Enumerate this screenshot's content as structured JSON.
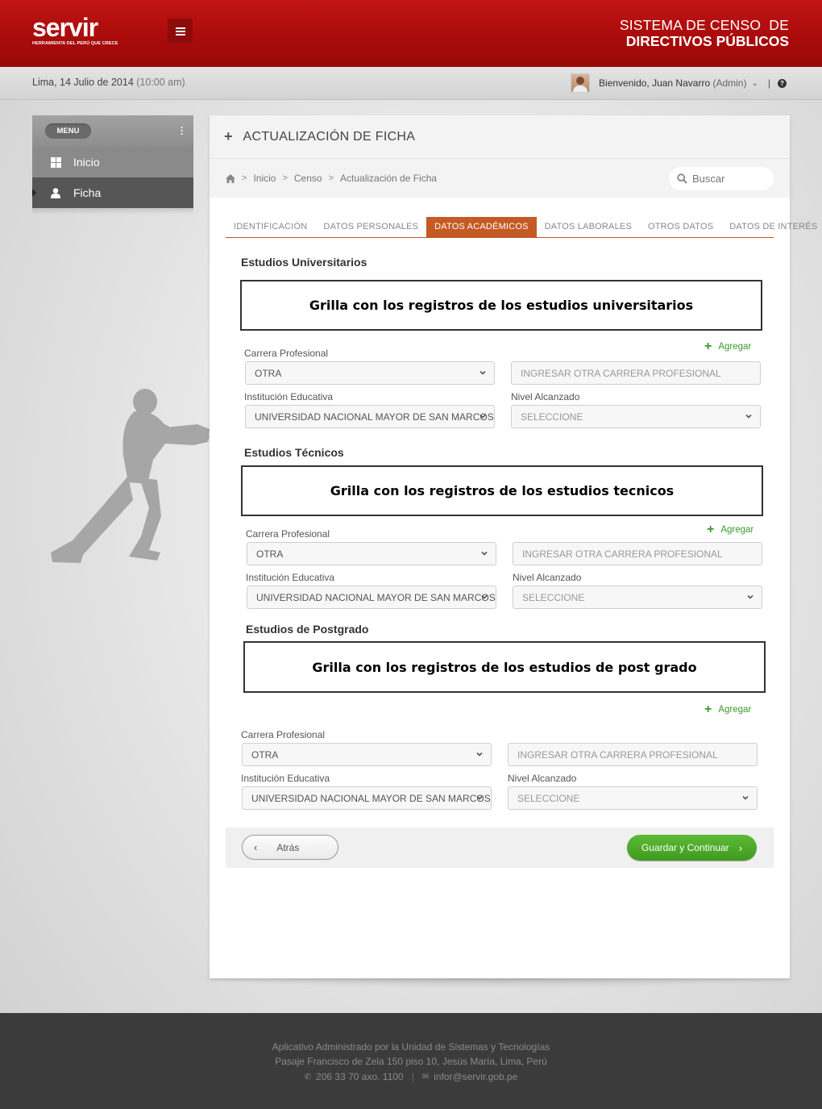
{
  "header": {
    "logo": "servir",
    "logo_tagline": "HERRAMIENTA DEL PERÚ QUE CRECE",
    "title_line1": "SISTEMA DE CENSO  DE",
    "title_line2": "DIRECTIVOS PÚBLICOS"
  },
  "subbar": {
    "date": "Lima, 14 Julio de 2014",
    "time": "(10:00 am)",
    "welcome": "Bienvenido, Juan Navarro",
    "role": "(Admin)",
    "separator": "|"
  },
  "sidebar": {
    "menu_label": "MENU",
    "items": [
      {
        "label": "Inicio",
        "icon": "windows-icon"
      },
      {
        "label": "Ficha",
        "icon": "user-icon"
      }
    ]
  },
  "panel": {
    "title": "ACTUALIZACIÓN DE FICHA",
    "breadcrumb": [
      "Inicio",
      "Censo",
      "Actualización de Ficha"
    ],
    "search_placeholder": "Buscar"
  },
  "tabs": [
    {
      "label": "IDENTIFICACIÓN",
      "active": false
    },
    {
      "label": "DATOS PERSONALES",
      "active": false
    },
    {
      "label": "DATOS ACADÉMICOS",
      "active": true
    },
    {
      "label": "DATOS LABORALES",
      "active": false
    },
    {
      "label": "OTROS DATOS",
      "active": false
    },
    {
      "label": "DATOS DE INTERÉS",
      "active": false
    }
  ],
  "sections": {
    "universitarios": {
      "title": "Estudios Universitarios",
      "grid_text": "Grilla con los registros de los estudios universitarios",
      "add": "Agregar",
      "carrera_label": "Carrera Profesional",
      "carrera_value": "OTRA",
      "otra_placeholder": "INGRESAR OTRA CARRERA PROFESIONAL",
      "institucion_label": "Institución Educativa",
      "institucion_value": "UNIVERSIDAD NACIONAL MAYOR DE SAN MARCOS",
      "nivel_label": "Nivel Alcanzado",
      "nivel_value": "SELECCIONE"
    },
    "tecnicos": {
      "title": "Estudios Técnicos",
      "grid_text": "Grilla con los registros de los estudios tecnicos",
      "add": "Agregar",
      "carrera_label": "Carrera Profesional",
      "carrera_value": "OTRA",
      "otra_placeholder": "INGRESAR OTRA CARRERA PROFESIONAL",
      "institucion_label": "Institución Educativa",
      "institucion_value": "UNIVERSIDAD NACIONAL MAYOR DE SAN MARCOS",
      "nivel_label": "Nivel Alcanzado",
      "nivel_value": "SELECCIONE"
    },
    "postgrado": {
      "title": "Estudios de Postgrado",
      "grid_text": "Grilla con los registros de los estudios de post grado",
      "add": "Agregar",
      "carrera_label": "Carrera Profesional",
      "carrera_value": "OTRA",
      "otra_placeholder": "INGRESAR OTRA CARRERA PROFESIONAL",
      "institucion_label": "Institución Educativa",
      "institucion_value": "UNIVERSIDAD NACIONAL MAYOR DE SAN MARCOS",
      "nivel_label": "Nivel Alcanzado",
      "nivel_value": "SELECCIONE"
    }
  },
  "actions": {
    "back": "Atrás",
    "next": "Guardar y Continuar"
  },
  "footer": {
    "line1": "Aplicativo Administrado por la Unidad de Sistemas y Tecnologías",
    "line2": "Pasaje Francisco de Zela 150 piso 10, Jesús María, Lima, Perú",
    "phone": "206 33 70 axo. 1100",
    "email": "infor@servir.gob.pe"
  },
  "colors": {
    "header_red": "#a80b0b",
    "tab_active": "#c45a24",
    "add_green": "#3a9a2e",
    "primary_button": "#4aa826"
  }
}
